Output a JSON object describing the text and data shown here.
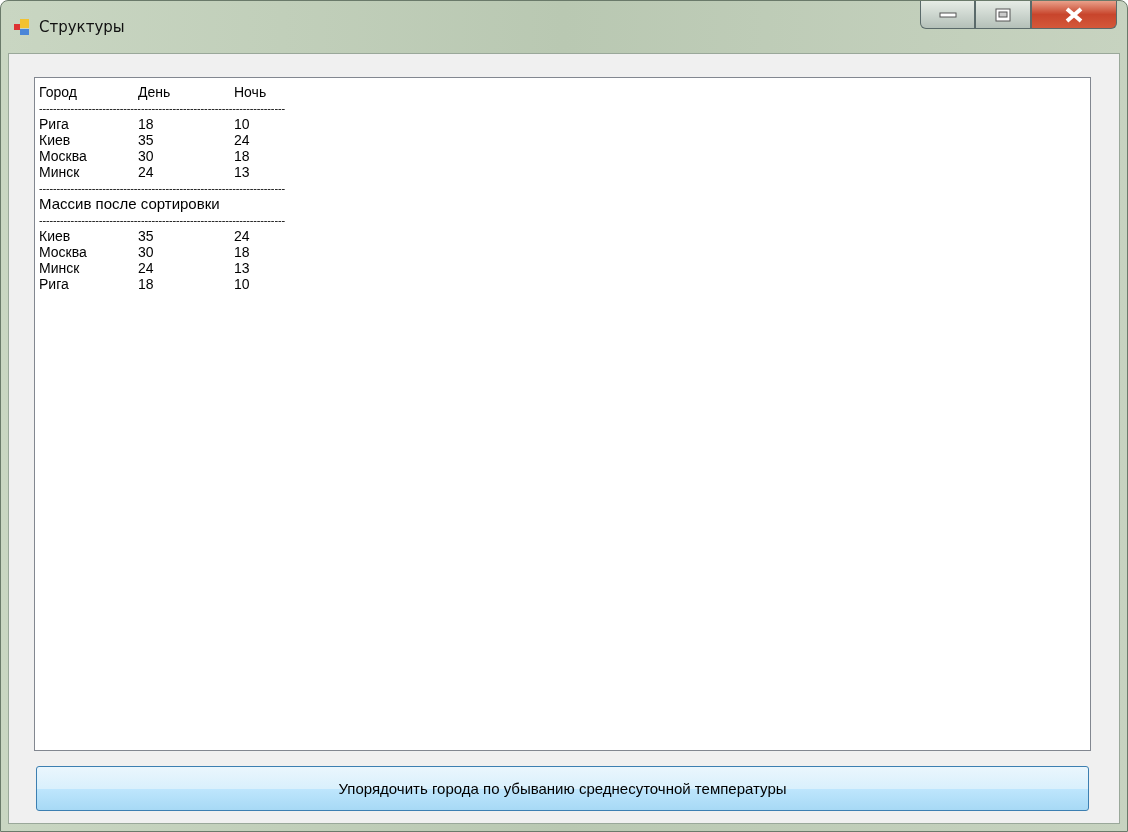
{
  "window": {
    "title": "Структуры"
  },
  "list_lines": [
    {
      "kind": "row",
      "cells": [
        "Город",
        "День",
        "Ночь"
      ]
    },
    {
      "kind": "rule",
      "text": "----------------------------------------------------------------------"
    },
    {
      "kind": "row",
      "cells": [
        "Рига",
        "18",
        "10"
      ]
    },
    {
      "kind": "row",
      "cells": [
        "Киев",
        "35",
        "24"
      ]
    },
    {
      "kind": "row",
      "cells": [
        "Москва",
        "30",
        "18"
      ]
    },
    {
      "kind": "row",
      "cells": [
        "Минск",
        "24",
        "13"
      ]
    },
    {
      "kind": "rule",
      "text": "----------------------------------------------------------------------"
    },
    {
      "kind": "text",
      "text": "Массив после сортировки"
    },
    {
      "kind": "rule",
      "text": "----------------------------------------------------------------------"
    },
    {
      "kind": "row",
      "cells": [
        "Киев",
        "35",
        "24"
      ]
    },
    {
      "kind": "row",
      "cells": [
        "Москва",
        "30",
        "18"
      ]
    },
    {
      "kind": "row",
      "cells": [
        "Минск",
        "24",
        "13"
      ]
    },
    {
      "kind": "row",
      "cells": [
        "Рига",
        "18",
        "10"
      ]
    }
  ],
  "button": {
    "label": "Упорядочить города по убыванию среднесуточной температуры"
  }
}
